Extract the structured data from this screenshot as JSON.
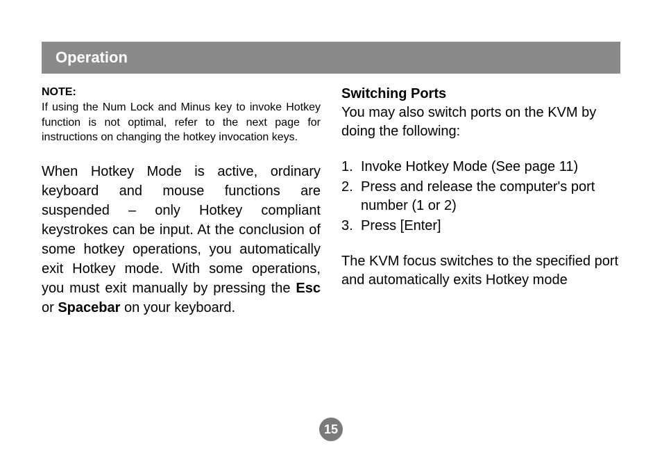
{
  "header": {
    "title": "Operation"
  },
  "left_column": {
    "note_heading": "NOTE:",
    "note_text": "If using the Num Lock and Minus key to invoke Hotkey function is not optimal, refer to the next page for instructions on changing the hotkey invocation keys.",
    "body_pre": "When Hotkey Mode is active, ordinary keyboard and mouse functions are suspended – only Hotkey compliant keystrokes can be input.  At the conclusion of some hotkey operations, you automatically exit Hotkey mode. With some operations, you must exit manually by pressing the ",
    "esc": "Esc",
    "or": " or ",
    "spacebar": "Spacebar",
    "body_post": " on your keyboard."
  },
  "right_column": {
    "heading": "Switching Ports",
    "intro": "You may also switch ports on the KVM by doing the following:",
    "steps": [
      {
        "num": "1.",
        "text": "Invoke Hotkey Mode (See page 11)"
      },
      {
        "num": "2.",
        "text": "Press and release the computer's port number (1 or 2)"
      },
      {
        "num": "3.",
        "text": "Press [Enter]"
      }
    ],
    "outro": "The KVM focus switches to the specified port and automatically exits Hotkey mode"
  },
  "page_number": "15"
}
